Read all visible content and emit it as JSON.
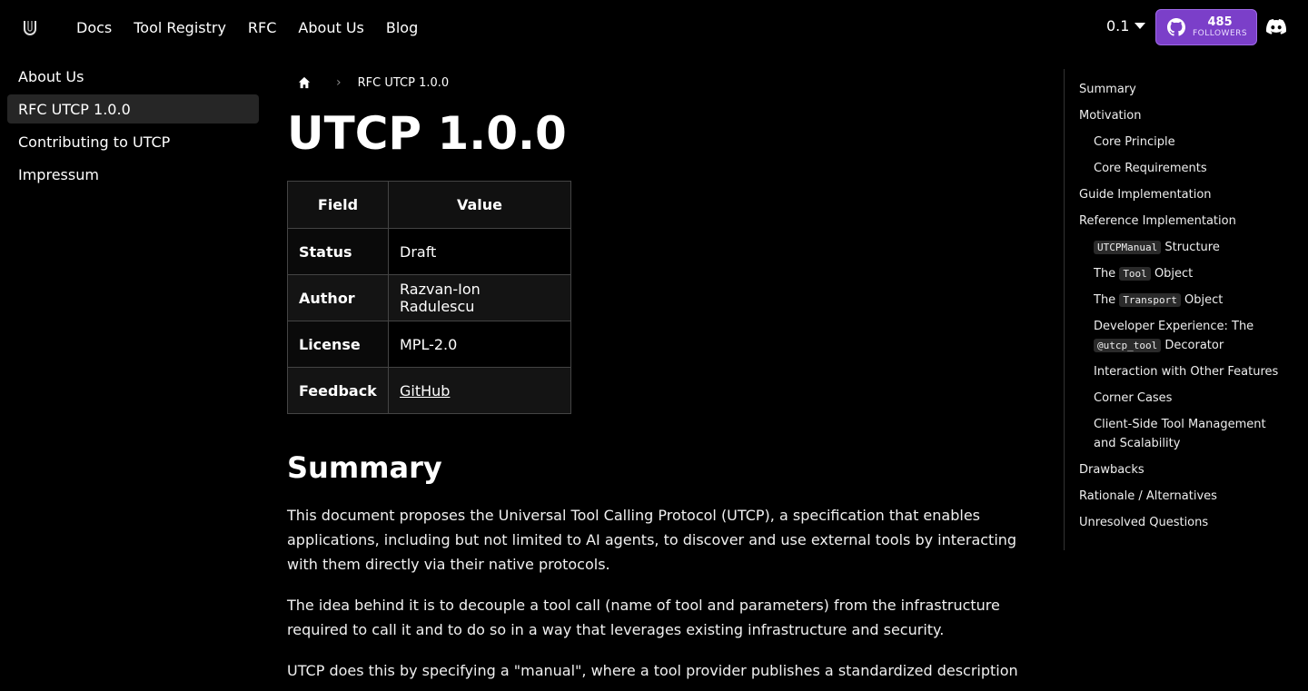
{
  "nav": {
    "links": [
      "Docs",
      "Tool Registry",
      "RFC",
      "About Us",
      "Blog"
    ],
    "version": "0.1",
    "github_count": "485",
    "github_label": "FOLLOWERS"
  },
  "sidebar": {
    "items": [
      "About Us",
      "RFC UTCP 1.0.0",
      "Contributing to UTCP",
      "Impressum"
    ],
    "active_index": 1
  },
  "breadcrumb": {
    "current": "RFC UTCP 1.0.0"
  },
  "page": {
    "title": "UTCP 1.0.0",
    "table": {
      "headers": [
        "Field",
        "Value"
      ],
      "rows": [
        {
          "key": "Status",
          "value": "Draft"
        },
        {
          "key": "Author",
          "value": "Razvan-Ion Radulescu"
        },
        {
          "key": "License",
          "value": "MPL-2.0"
        },
        {
          "key": "Feedback",
          "value": "GitHub"
        }
      ]
    },
    "summary_heading": "Summary",
    "paragraphs": [
      "This document proposes the Universal Tool Calling Protocol (UTCP), a specification that enables applications, including but not limited to AI agents, to discover and use external tools by interacting with them directly via their native protocols.",
      "The idea behind it is to decouple a tool call (name of tool and parameters) from the infrastructure required to call it and to do so in a way that leverages existing infrastructure and security.",
      "UTCP does this by specifying a \"manual\", where a tool provider publishes a standardized description"
    ]
  },
  "toc": {
    "summary": "Summary",
    "motivation": "Motivation",
    "core_principle": "Core Principle",
    "core_requirements": "Core Requirements",
    "guide_impl": "Guide Implementation",
    "reference_impl": "Reference Implementation",
    "utcpmanual_code": "UTCPManual",
    "utcpmanual_rest": " Structure",
    "tool_pre": "The ",
    "tool_code": "Tool",
    "tool_post": " Object",
    "transport_pre": "The ",
    "transport_code": "Transport",
    "transport_post": " Object",
    "devx_pre": "Developer Experience: The ",
    "devx_code": "@utcp_tool",
    "devx_post": " Decorator",
    "interaction": "Interaction with Other Features",
    "corner_cases": "Corner Cases",
    "client_side": "Client-Side Tool Management and Scalability",
    "drawbacks": "Drawbacks",
    "rationale": "Rationale / Alternatives",
    "unresolved": "Unresolved Questions"
  }
}
